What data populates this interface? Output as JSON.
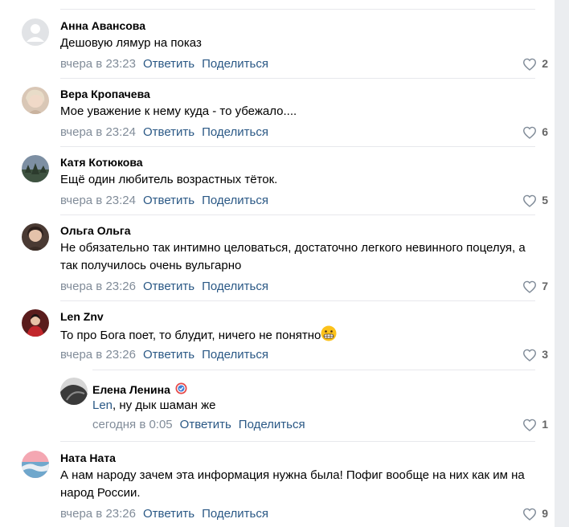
{
  "comments": [
    {
      "name": "Анна Авансова",
      "text": "Дешовую лямур на показ",
      "time": "вчера в 23:23",
      "reply": "Ответить",
      "share": "Поделиться",
      "likes": "2"
    },
    {
      "name": "Вера Кропачева",
      "text": "Мое уважение к нему куда - то убежало....",
      "time": "вчера в 23:24",
      "reply": "Ответить",
      "share": "Поделиться",
      "likes": "6"
    },
    {
      "name": "Катя Котюкова",
      "text": "Ещё один любитель возрастных тёток.",
      "time": "вчера в 23:24",
      "reply": "Ответить",
      "share": "Поделиться",
      "likes": "5"
    },
    {
      "name": "Ольга Ольга",
      "text": "Не обязательно так интимно целоваться, достаточно легкого невинного поцелуя, а так получилось очень вульгарно",
      "time": "вчера в 23:26",
      "reply": "Ответить",
      "share": "Поделиться",
      "likes": "7"
    },
    {
      "name": "Len Znv",
      "text": "То про Бога поет, то блудит, ничего не понятно",
      "emoji": "grimacing-face-emoji",
      "time": "вчера в 23:26",
      "reply": "Ответить",
      "share": "Поделиться",
      "likes": "3"
    },
    {
      "name": "Елена Ленина",
      "mention": "Len",
      "text": ", ну дык шаман же",
      "time": "сегодня в 0:05",
      "reply": "Ответить",
      "share": "Поделиться",
      "likes": "1",
      "badge_icon": "verified-badge-icon"
    },
    {
      "name": "Ната Ната",
      "text": "А нам народу зачем эта информация нужна была! Пофиг вообще на них как им на народ России.",
      "time": "вчера в 23:26",
      "reply": "Ответить",
      "share": "Поделиться",
      "likes": "9"
    }
  ],
  "colors": {
    "link": "#2a5885",
    "meta": "#818c99",
    "separator": "#e7e8ec",
    "background": "#ffffff"
  }
}
